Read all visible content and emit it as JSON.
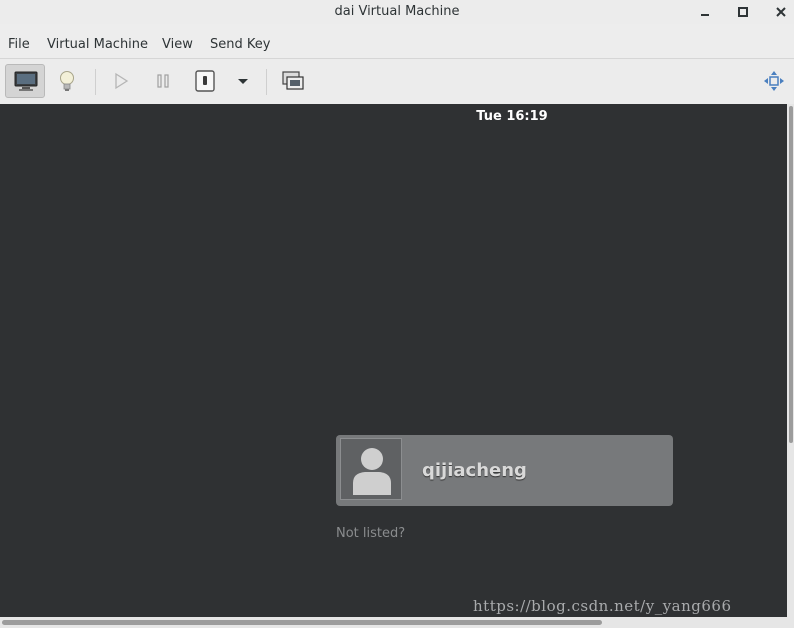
{
  "window": {
    "title": "dai Virtual Machine"
  },
  "menu": {
    "items": [
      {
        "label": "File"
      },
      {
        "label": "Virtual Machine"
      },
      {
        "label": "View"
      },
      {
        "label": "Send Key"
      }
    ]
  },
  "toolbar": {
    "buttons": [
      {
        "icon": "monitor-icon",
        "active": true
      },
      {
        "icon": "lightbulb-icon"
      },
      {
        "icon": "play-icon"
      },
      {
        "icon": "pause-icon"
      },
      {
        "icon": "power-icon"
      },
      {
        "icon": "dropdown-arrow-icon"
      },
      {
        "icon": "snapshot-icon"
      },
      {
        "icon": "fullscreen-icon"
      }
    ]
  },
  "guest": {
    "clock": "Tue 16:19",
    "username": "qijiacheng",
    "not_listed": "Not listed?",
    "watermark": "https://blog.csdn.net/y_yang666"
  },
  "colors": {
    "display_bg": "#2f3133",
    "card_bg": "#77797b",
    "chrome_bg": "#ededed"
  }
}
